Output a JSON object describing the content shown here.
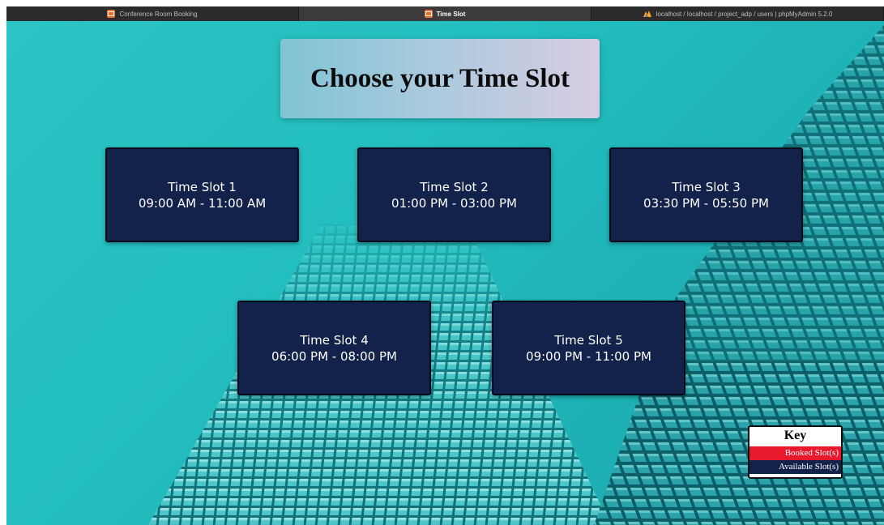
{
  "browser": {
    "tabs": [
      {
        "label": "Conference Room Booking",
        "icon": "calendar-app-icon",
        "active": false
      },
      {
        "label": "Time Slot",
        "icon": "calendar-app-icon",
        "active": true
      },
      {
        "label": "localhost / localhost / project_adp / users | phpMyAdmin 5.2.0",
        "icon": "phpmyadmin-icon",
        "active": false
      }
    ]
  },
  "page": {
    "title": "Choose your Time Slot"
  },
  "slots": [
    {
      "name": "Time Slot 1",
      "time": "09:00 AM - 11:00 AM"
    },
    {
      "name": "Time Slot 2",
      "time": "01:00 PM - 03:00 PM"
    },
    {
      "name": "Time Slot 3",
      "time": "03:30 PM - 05:50 PM"
    },
    {
      "name": "Time Slot 4",
      "time": "06:00 PM - 08:00 PM"
    },
    {
      "name": "Time Slot 5",
      "time": "09:00 PM - 11:00 PM"
    }
  ],
  "key": {
    "title": "Key",
    "booked_label": "Booked Slot(s)",
    "available_label": "Available Slot(s)"
  },
  "colors": {
    "available": "#13224a",
    "booked": "#e8192c",
    "background": "#24bfc0"
  }
}
